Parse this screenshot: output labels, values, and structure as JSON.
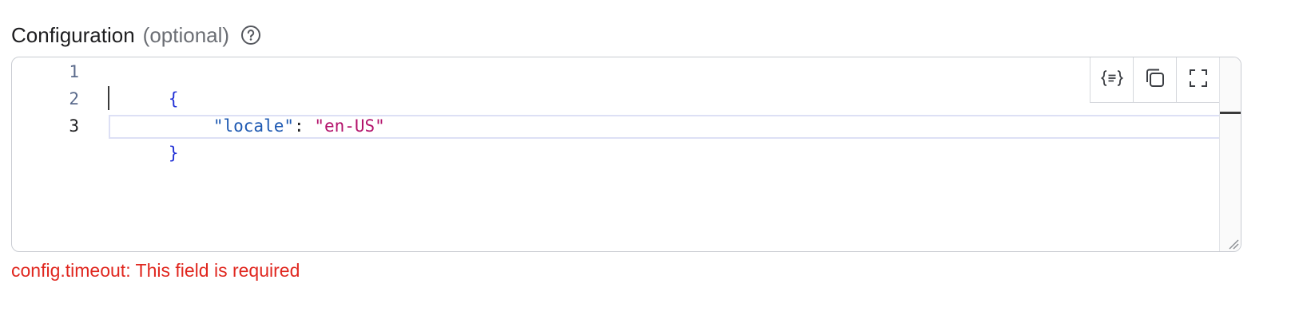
{
  "field": {
    "label": "Configuration",
    "optional_label": "(optional)",
    "help_icon": "question-circle-icon"
  },
  "editor": {
    "line_numbers": [
      "1",
      "2",
      "3"
    ],
    "lines": {
      "open_brace": "{",
      "key": "\"locale\"",
      "colon": ": ",
      "value": "\"en-US\"",
      "close_brace": "}"
    },
    "active_line": 3,
    "toolbar": {
      "format_icon": "format-json-icon",
      "copy_icon": "copy-icon",
      "fullscreen_icon": "fullscreen-icon"
    }
  },
  "error_message": "config.timeout: This field is required",
  "colors": {
    "error": "#e0271f",
    "brace": "#2130d6",
    "key": "#1e59b2",
    "string": "#b3126b"
  }
}
